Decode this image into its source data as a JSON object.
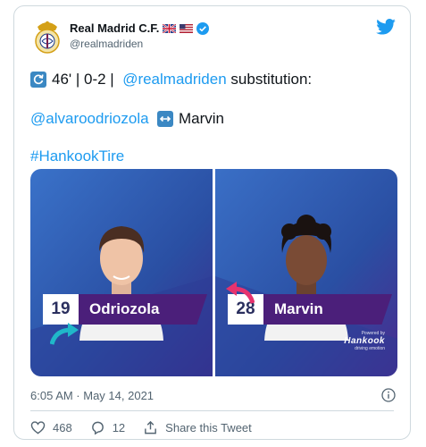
{
  "account": {
    "display_name": "Real Madrid C.F.",
    "handle": "@realmadriden",
    "verified": true,
    "flags": [
      "uk-flag",
      "us-flag"
    ]
  },
  "tweet": {
    "line1_time": "46' | 0-2 |",
    "line1_mention": "@realmadriden",
    "line1_text": "substitution:",
    "line2_mention": "@alvaroodriozola",
    "line2_text": "Marvin",
    "hashtag": "#HankookTire"
  },
  "media": {
    "panels": [
      {
        "number": "19",
        "name": "Odriozola"
      },
      {
        "number": "28",
        "name": "Marvin"
      }
    ],
    "sponsor": {
      "powered": "Powered by",
      "brand": "Hankook",
      "tagline": "driving emotion"
    }
  },
  "meta": {
    "timestamp": "6:05 AM · May 14, 2021"
  },
  "actions": {
    "likes": "468",
    "replies": "12",
    "share_label": "Share this Tweet"
  },
  "colors": {
    "link": "#1d9bf0",
    "panel_blue": "#2e5bb0",
    "panel_purple": "#4b1f7a",
    "arrow_in": "#20b8c9",
    "arrow_out": "#e6336e"
  }
}
